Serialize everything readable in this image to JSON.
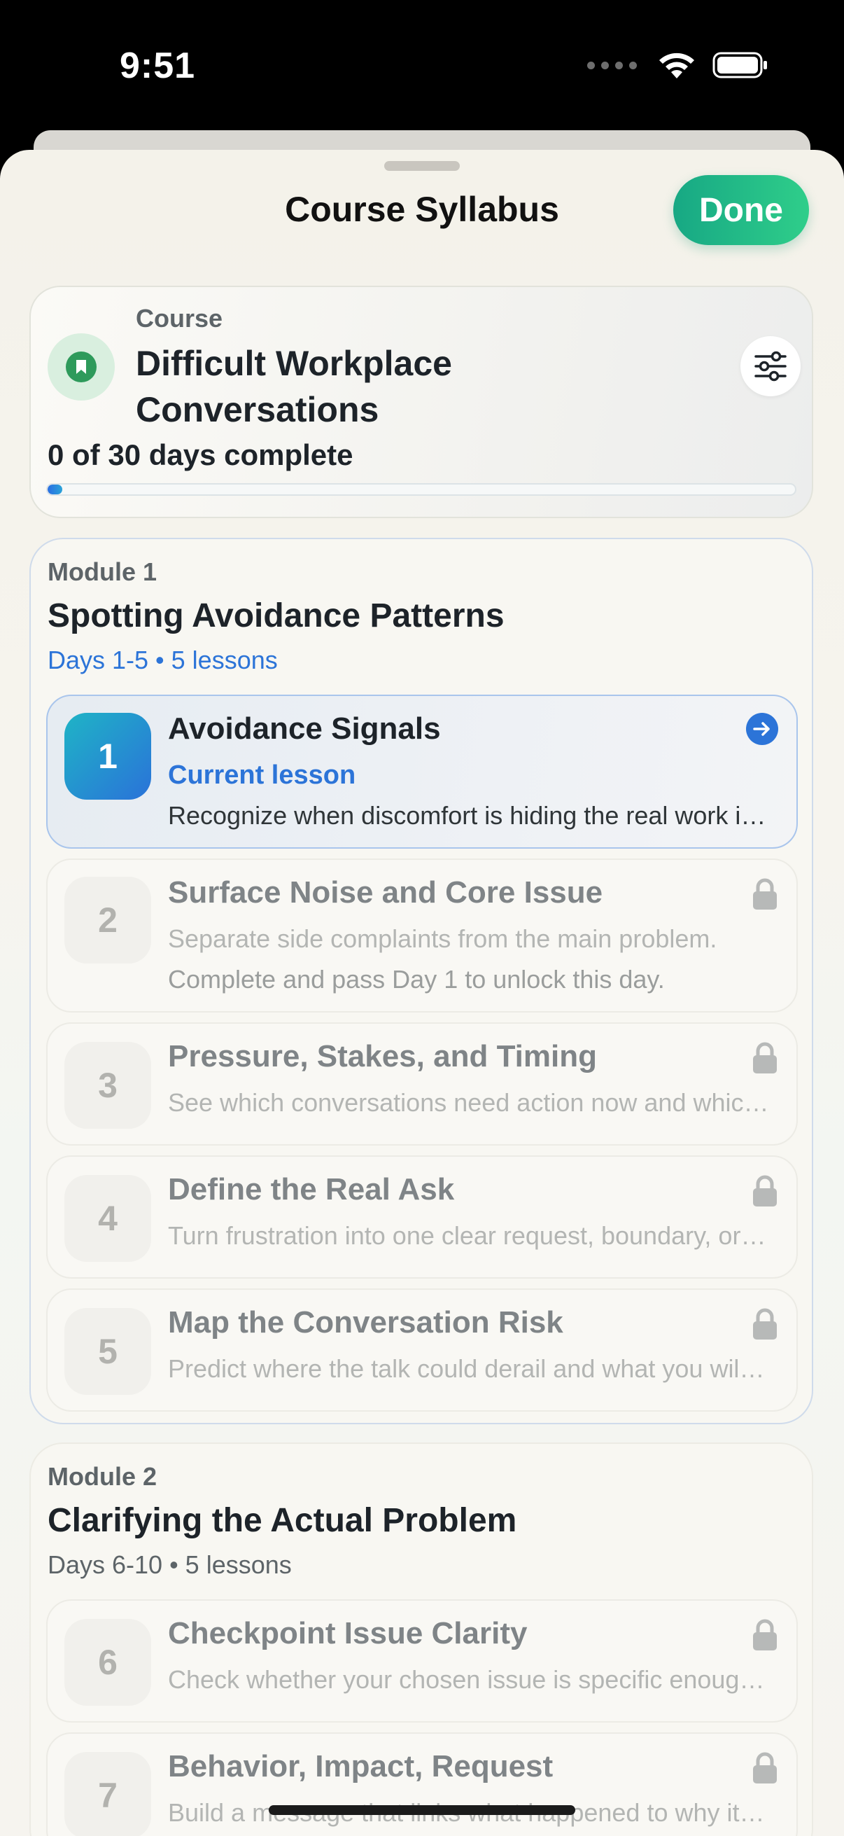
{
  "status_bar": {
    "time": "9:51",
    "icons": [
      "cellular-dots-icon",
      "wifi-icon",
      "battery-icon"
    ]
  },
  "sheet": {
    "title": "Course Syllabus",
    "done_label": "Done"
  },
  "course": {
    "kicker": "Course",
    "name": "Difficult Workplace Conversations",
    "progress_text": "0 of 30 days complete",
    "progress_fraction": 0.02,
    "icon": "bookmark-icon",
    "filter_icon": "sliders-icon"
  },
  "modules": [
    {
      "kicker": "Module 1",
      "title": "Spotting Avoidance Patterns",
      "subtitle": "Days 1-5 • 5 lessons",
      "lessons": [
        {
          "number": "1",
          "title": "Avoidance Signals",
          "status": "Current lesson",
          "desc": "Recognize when discomfort is hiding the real work issue."
        },
        {
          "number": "2",
          "title": "Surface Noise and Core Issue",
          "desc": "Separate side complaints from the main problem.",
          "note": "Complete and pass Day 1 to unlock this day."
        },
        {
          "number": "3",
          "title": "Pressure, Stakes, and Timing",
          "desc": "See which conversations need action now and which can wait."
        },
        {
          "number": "4",
          "title": "Define the Real Ask",
          "desc": "Turn frustration into one clear request, boundary, or decision."
        },
        {
          "number": "5",
          "title": "Map the Conversation Risk",
          "desc": "Predict where the talk could derail and what you will do."
        }
      ]
    },
    {
      "kicker": "Module 2",
      "title": "Clarifying the Actual Problem",
      "subtitle": "Days 6-10 • 5 lessons",
      "lessons": [
        {
          "number": "6",
          "title": "Checkpoint Issue Clarity",
          "desc": "Check whether your chosen issue is specific enough to discuss."
        },
        {
          "number": "7",
          "title": "Behavior, Impact, Request",
          "desc": "Build a message that links what happened to why it matters."
        }
      ]
    }
  ],
  "colors": {
    "accent_blue": "#2c74d8",
    "done_green": "#1fb388",
    "course_icon_green": "#2e9a5b"
  }
}
